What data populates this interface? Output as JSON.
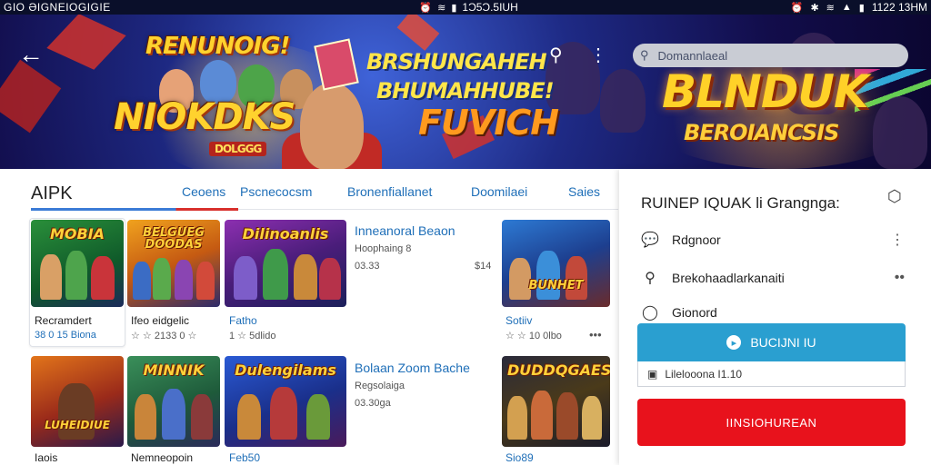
{
  "status_bar": {
    "left_text": "GIO ƏIGNEIOGIGIE",
    "clock_mid": "1Ɔ5Ɔ.5IUH",
    "clock_right": "1122 13HM"
  },
  "banner": {
    "logo_line1": "RENUNOIG!",
    "logo_line2": "NIOKDKS",
    "logo_badge": "DOLGGG",
    "promo_line1": "BRSHUNGAHEH",
    "promo_line2": "BHUMAHHUBE!",
    "promo_line3": "FUVICH",
    "headline": "BLNDUK",
    "headline_sub": "BEROIANCSIS",
    "search_placeholder": "Domannlaeal"
  },
  "icons": {
    "back": "back-arrow-icon",
    "search": "search-icon",
    "more": "more-vertical-icon"
  },
  "page_title": "AIPK",
  "tabs": [
    "Ceoens",
    "Pscnecocsm",
    "Bronenfiallanet",
    "Doomilaei",
    "Saies"
  ],
  "accent_colors": {
    "blue": "#1f6fb8",
    "red": "#e8121c",
    "cyan": "#2a9fd0"
  },
  "games_row1": [
    {
      "art_title": "MOBIA",
      "title": "Recramdert",
      "meta": "38  0  15  Biona"
    },
    {
      "art_title": "BELGUEG DOODAS",
      "title": "Ifeo eidgelic",
      "meta": "☆  ☆  2133  0 ☆"
    },
    {
      "art_title": "Dilinoanlis",
      "title": "Fatho",
      "meta": "1  ☆  5dlido"
    }
  ],
  "featured_row1": {
    "title": "Inneanoral Beaon",
    "sub": "Hoophaing 8",
    "size": "03.33",
    "count": "$14"
  },
  "game_right1": {
    "art_title": "BUNHET",
    "title": "Sotiiv",
    "meta": "☆  ☆  10  0lbo"
  },
  "games_row2": [
    {
      "art_title": "LUHEIDIUE",
      "title": "Iaois"
    },
    {
      "art_title": "MINNIK",
      "title": "Nemneopoin"
    },
    {
      "art_title": "Dulengilams",
      "title": "Feb50"
    }
  ],
  "featured_row2": {
    "title": "Bolaan Zoom Bache",
    "sub": "Regsolaiga",
    "size": "03.30ga"
  },
  "game_right2": {
    "art_title": "DUDDQGAES",
    "title": "Sio89"
  },
  "panel": {
    "title": "RUINEP IQUAK li Grangnga:",
    "rows": [
      {
        "icon": "chat-icon",
        "label": "Rdgnoor"
      },
      {
        "icon": "search-icon",
        "label": "Brekohaadlarkanaiti"
      },
      {
        "icon": "location-pin-icon",
        "label": "Gionord"
      }
    ],
    "primary_button": "BUCIJNI IU",
    "info_text": "Lilelooona I1.10",
    "danger_button": "IINSIOHUREAN"
  }
}
